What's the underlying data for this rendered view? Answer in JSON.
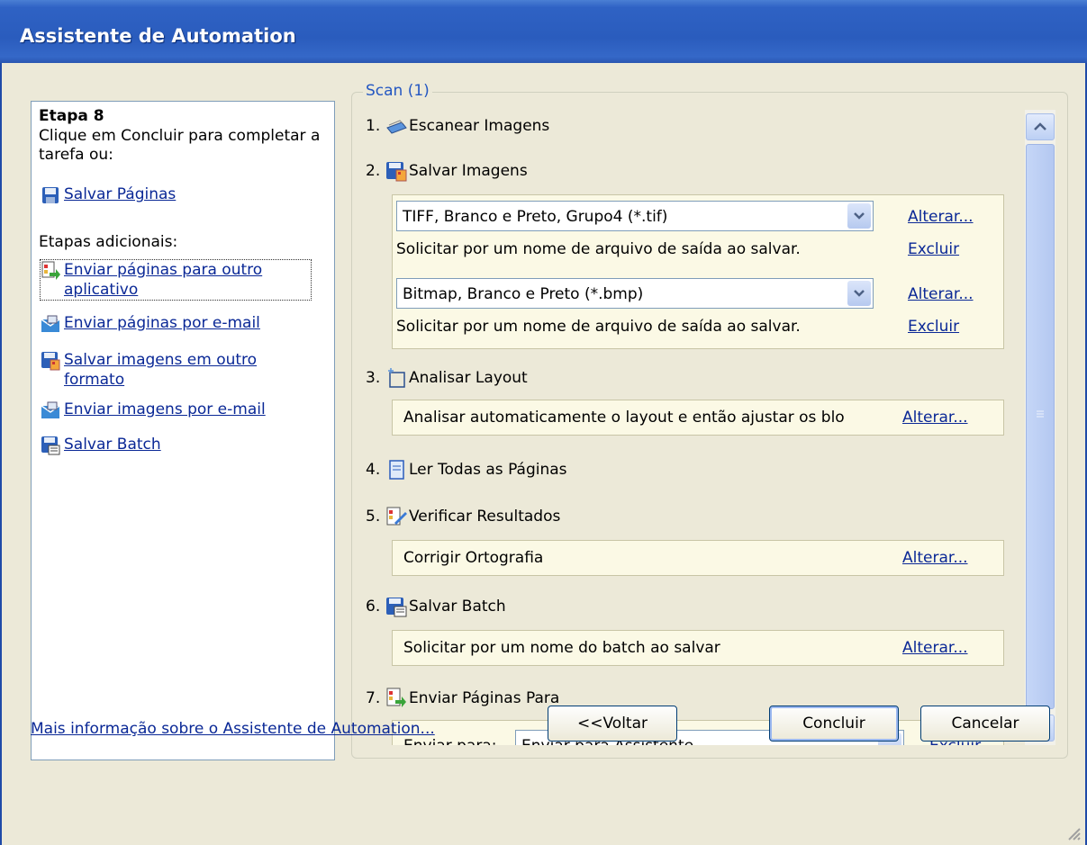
{
  "window": {
    "title": "Assistente de Automation"
  },
  "left_pane": {
    "step_title": "Etapa 8",
    "step_desc": "Clique em Concluir para completar a tarefa ou:",
    "save_pages_link": "Salvar Páginas",
    "additional_label": "Etapas adicionais:",
    "links": [
      {
        "label": "Enviar páginas para outro aplicativo",
        "icon": "send-pages-icon"
      },
      {
        "label": "Enviar páginas por e-mail",
        "icon": "email-icon"
      },
      {
        "label": "Salvar imagens em outro formato",
        "icon": "save-images-icon"
      },
      {
        "label": "Enviar imagens por e-mail",
        "icon": "email-icon"
      },
      {
        "label": "Salvar Batch",
        "icon": "save-batch-icon"
      }
    ]
  },
  "group": {
    "legend": "Scan (1)",
    "steps": [
      {
        "num": "1.",
        "label": "Escanear Imagens",
        "icon": "scanner-icon"
      },
      {
        "num": "2.",
        "label": "Salvar Imagens",
        "icon": "save-images-icon"
      },
      {
        "num": "3.",
        "label": "Analisar Layout",
        "icon": "layout-icon"
      },
      {
        "num": "4.",
        "label": "Ler Todas as Páginas",
        "icon": "page-icon"
      },
      {
        "num": "5.",
        "label": "Verificar Resultados",
        "icon": "verify-icon"
      },
      {
        "num": "6.",
        "label": "Salvar Batch",
        "icon": "save-batch-icon"
      },
      {
        "num": "7.",
        "label": "Enviar Páginas Para",
        "icon": "send-pages-icon"
      }
    ],
    "save_formats": [
      {
        "format": "TIFF, Branco e Preto, Grupo4 (*.tif)",
        "prompt": "Solicitar por um nome de arquivo de saída ao salvar.",
        "change": "Alterar...",
        "delete": "Excluir"
      },
      {
        "format": "Bitmap, Branco e Preto (*.bmp)",
        "prompt": "Solicitar por um nome de arquivo de saída ao salvar.",
        "change": "Alterar...",
        "delete": "Excluir"
      }
    ],
    "layout_panel": {
      "text": "Analisar automaticamente o layout e então ajustar os blo",
      "change": "Alterar..."
    },
    "verify_panel": {
      "text": "Corrigir Ortografia",
      "change": "Alterar..."
    },
    "batch_panel": {
      "text": "Solicitar por um nome do batch ao salvar",
      "change": "Alterar..."
    },
    "send_panel": {
      "label": "Enviar para:",
      "value": "Enviar para Assistente",
      "delete": "Excluir"
    }
  },
  "footer": {
    "more_info": "Mais informação sobre o Assistente de Automation...",
    "back": "<<Voltar",
    "finish": "Concluir",
    "cancel": "Cancelar"
  },
  "colors": {
    "title_bar": "#2a5cbd",
    "link": "#0a2896",
    "legend": "#2457c2",
    "panel_bg": "#fbf9e5"
  }
}
